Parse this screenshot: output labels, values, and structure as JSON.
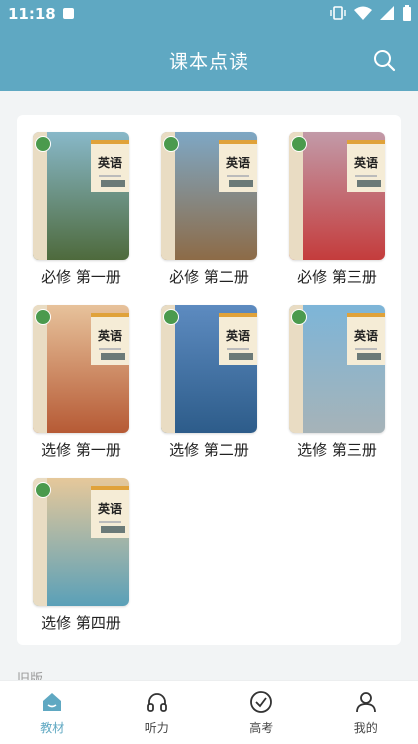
{
  "status": {
    "time": "11:18"
  },
  "header": {
    "title": "课本点读"
  },
  "books": [
    {
      "label": "必修 第一册",
      "cover_top": "#88b8c9",
      "cover_bottom": "#4e6a3c",
      "cover_cn": "英语"
    },
    {
      "label": "必修 第二册",
      "cover_top": "#7ea7c4",
      "cover_bottom": "#8d6b47",
      "cover_cn": "英语"
    },
    {
      "label": "必修 第三册",
      "cover_top": "#c29aa8",
      "cover_bottom": "#c43c3c",
      "cover_cn": "英语"
    },
    {
      "label": "选修 第一册",
      "cover_top": "#e7c29b",
      "cover_bottom": "#b65a35",
      "cover_cn": "英语"
    },
    {
      "label": "选修 第二册",
      "cover_top": "#5d8bc0",
      "cover_bottom": "#2d5c8a",
      "cover_cn": "英语"
    },
    {
      "label": "选修 第三册",
      "cover_top": "#7db5d8",
      "cover_bottom": "#a6b3b8",
      "cover_cn": "英语"
    },
    {
      "label": "选修 第四册",
      "cover_top": "#e6c89a",
      "cover_bottom": "#5aa0b8",
      "cover_cn": "英语"
    }
  ],
  "section_label": "旧版",
  "tabs": [
    {
      "label": "教材",
      "icon": "home-icon"
    },
    {
      "label": "听力",
      "icon": "headphones-icon"
    },
    {
      "label": "高考",
      "icon": "check-circle-icon"
    },
    {
      "label": "我的",
      "icon": "user-icon"
    }
  ],
  "colors": {
    "accent": "#5fa8c2",
    "background": "#f2f4f5"
  }
}
